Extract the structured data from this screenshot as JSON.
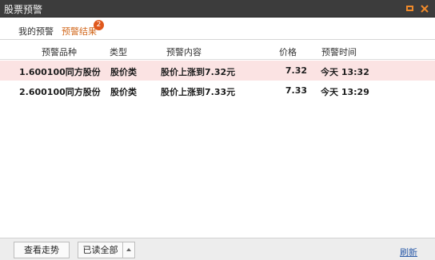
{
  "window": {
    "title": "股票预警"
  },
  "tabs": [
    {
      "label": "我的预警"
    },
    {
      "label": "预警结果",
      "badge": "2"
    }
  ],
  "table": {
    "headers": [
      "预警品种",
      "类型",
      "预警内容",
      "价格",
      "预警时间"
    ],
    "rows": [
      {
        "name": "1.600100同方股份",
        "type": "股价类",
        "content": "股价上涨到7.32元",
        "price": "7.32",
        "time": "今天 13:32"
      },
      {
        "name": "2.600100同方股份",
        "type": "股价类",
        "content": "股价上涨到7.33元",
        "price": "7.33",
        "time": "今天 13:29"
      }
    ]
  },
  "footer": {
    "trend_label": "查看走势",
    "read_all_label": "已读全部",
    "refresh_label": "刷新"
  },
  "colors": {
    "titlebar": "#3c3c3c",
    "accent": "#e07a1e",
    "selected_row": "#fbe3e3",
    "badge": "#e0581c",
    "link": "#2a5aa8"
  },
  "icons": [
    "minimize-icon",
    "close-icon",
    "caret-up-icon"
  ]
}
